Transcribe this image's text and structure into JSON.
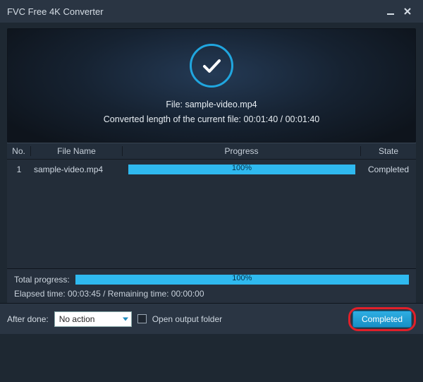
{
  "window": {
    "title": "FVC Free 4K Converter"
  },
  "hero": {
    "file_label": "File: sample-video.mp4",
    "converted_line": "Converted length of the current file: 00:01:40 / 00:01:40"
  },
  "grid": {
    "headers": {
      "no": "No.",
      "filename": "File Name",
      "progress": "Progress",
      "state": "State"
    },
    "rows": [
      {
        "no": "1",
        "filename": "sample-video.mp4",
        "progress_pct": "100%",
        "state": "Completed"
      }
    ]
  },
  "totals": {
    "label": "Total progress:",
    "pct": "100%",
    "times": "Elapsed time: 00:03:45 / Remaining time: 00:00:00"
  },
  "footer": {
    "after_done_label": "After done:",
    "after_done_value": "No action",
    "open_folder_label": "Open output folder",
    "completed_button": "Completed"
  }
}
